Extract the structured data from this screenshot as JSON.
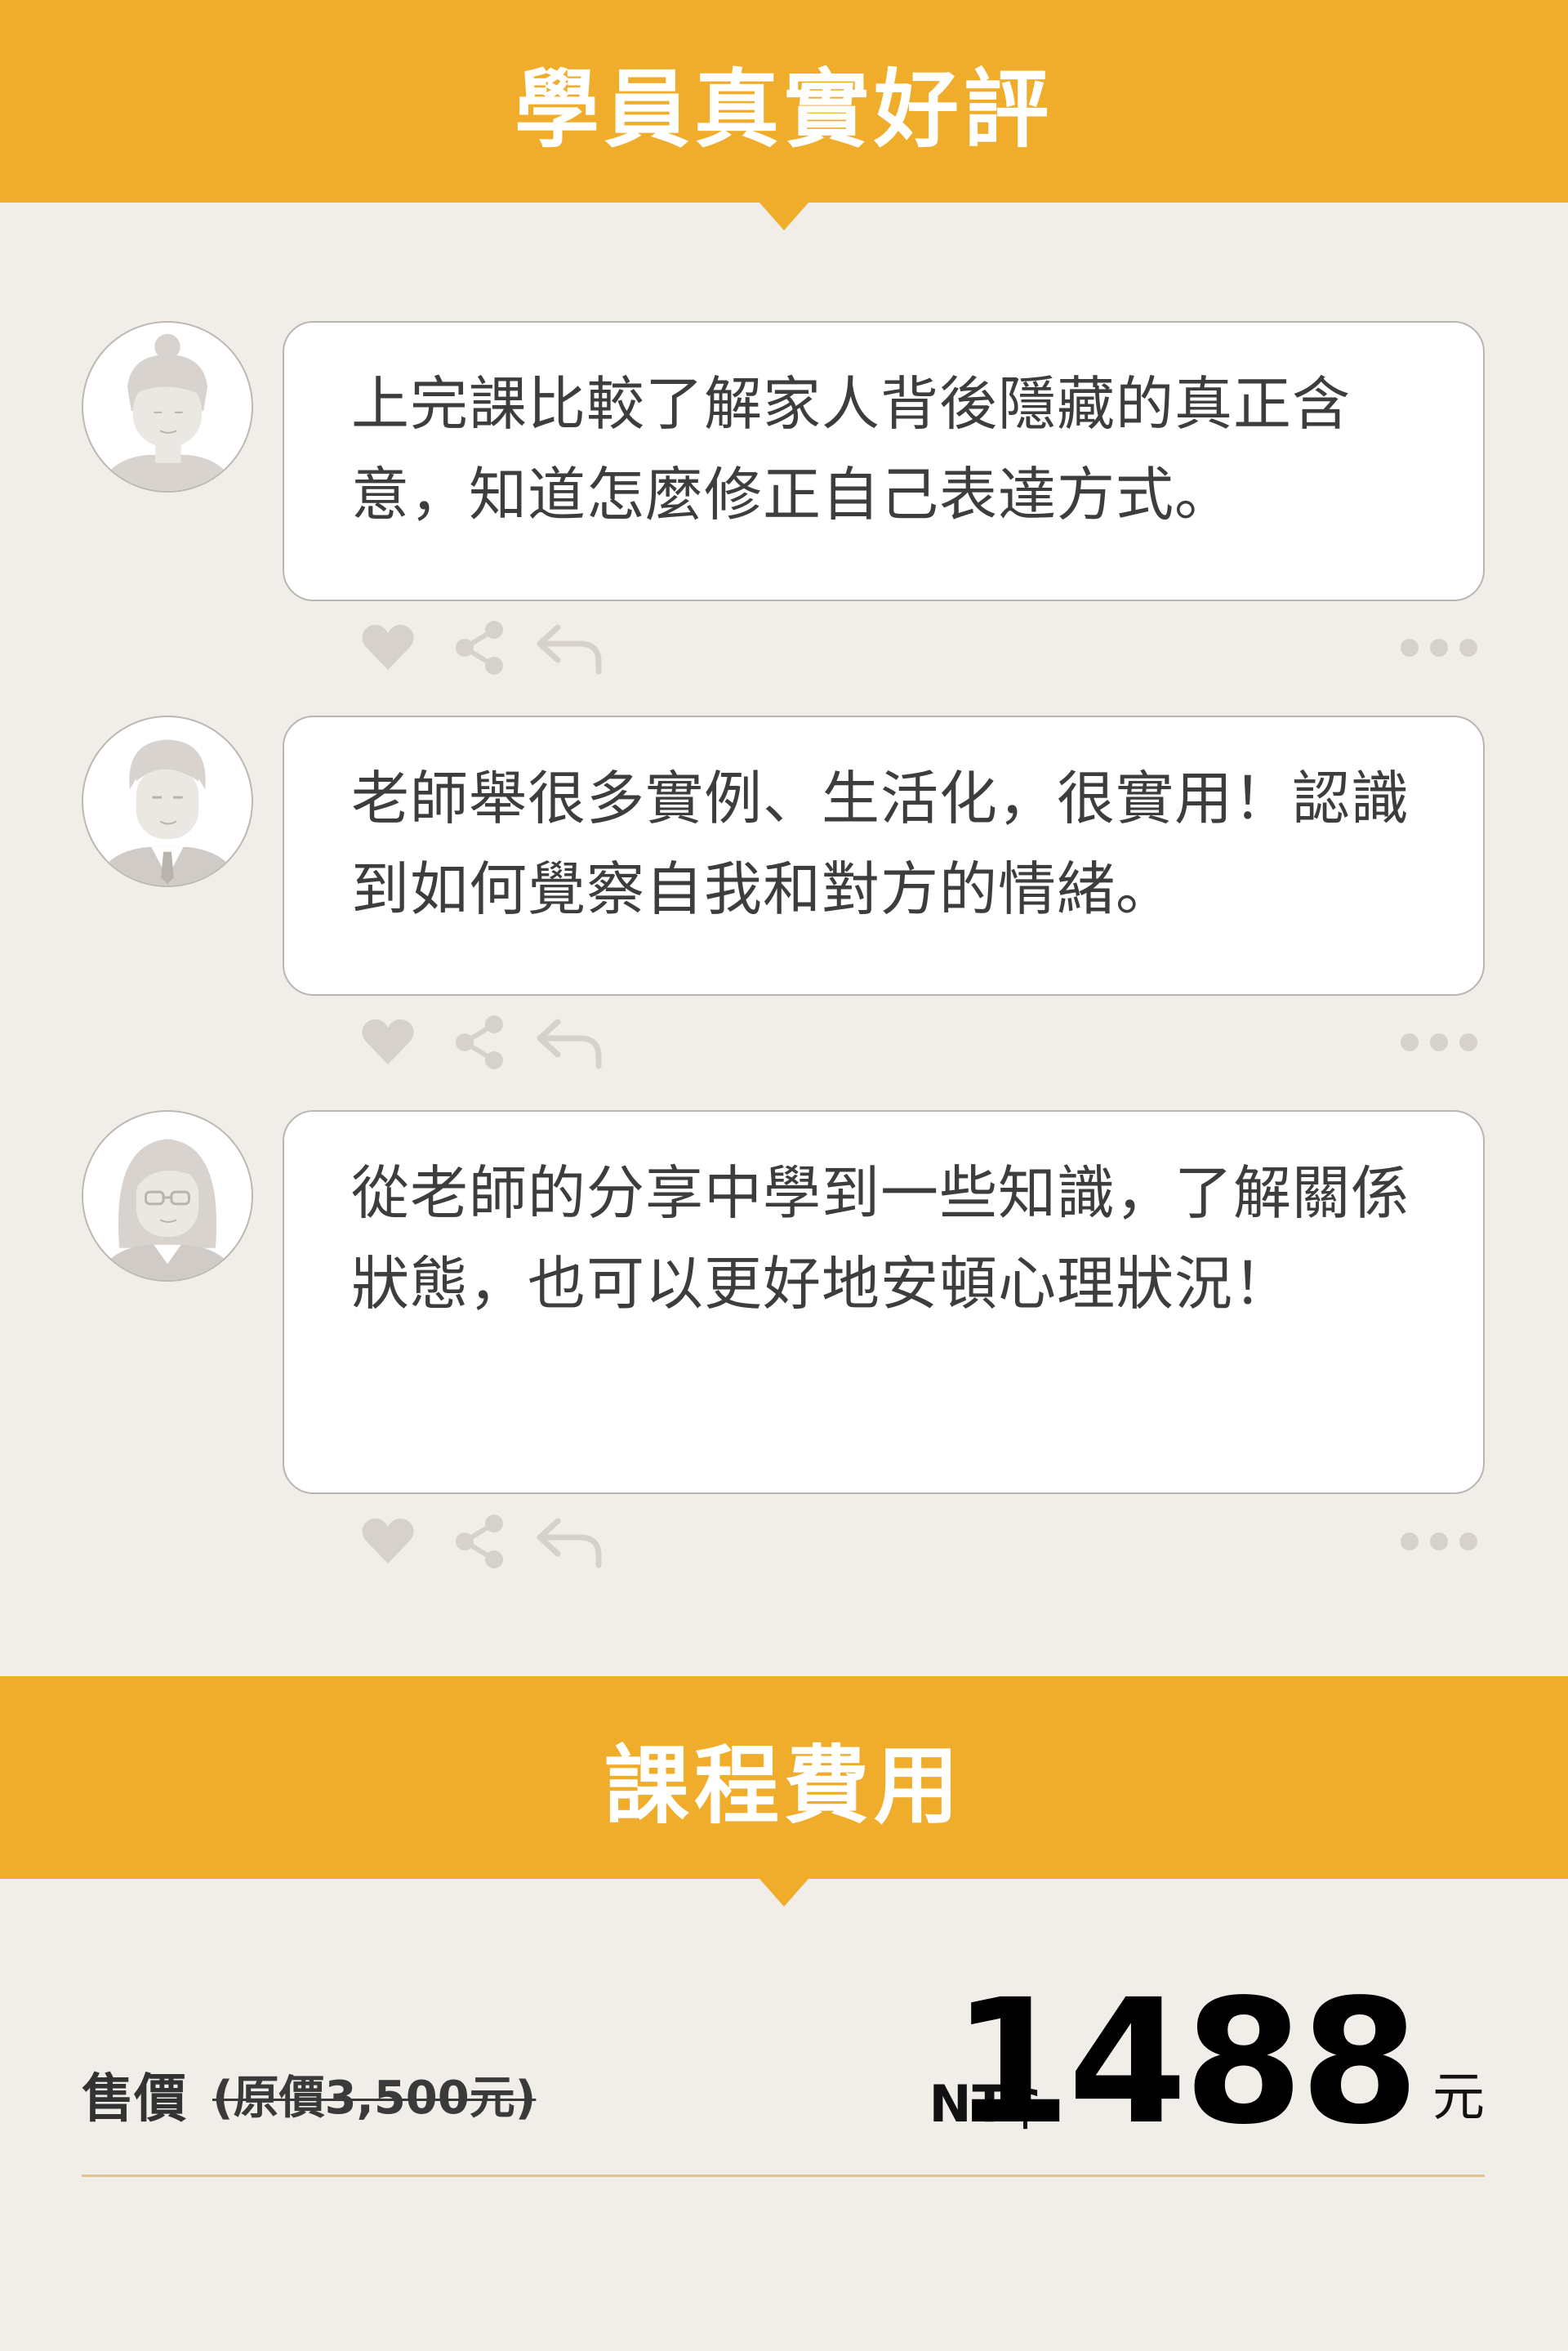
{
  "reviews_section": {
    "title": "學員真實好評"
  },
  "reviews": [
    {
      "avatar": "female-bun-icon",
      "text": "上完課比較了解家人背後隱藏的真正含意，知道怎麼修正自己表達方式。"
    },
    {
      "avatar": "male-suit-icon",
      "text": "老師舉很多實例、生活化，很實用！認識到如何覺察自我和對方的情緒。"
    },
    {
      "avatar": "female-glasses-icon",
      "text": "從老師的分享中學到一些知識，了解關係狀態，也可以更好地安頓心理狀況！"
    }
  ],
  "actions": {
    "icons": [
      "heart-icon",
      "share-icon",
      "reply-icon",
      "more-icon"
    ]
  },
  "pricing_section": {
    "title": "課程費用",
    "label": "售價",
    "original_price": "(原價3,500元)",
    "currency": "NT$",
    "price": "1488",
    "unit": "元"
  },
  "colors": {
    "accent": "#f0ad2c",
    "background": "#f1ede9",
    "icon_gray": "#d6d1cc",
    "divider": "#e0c58e"
  }
}
